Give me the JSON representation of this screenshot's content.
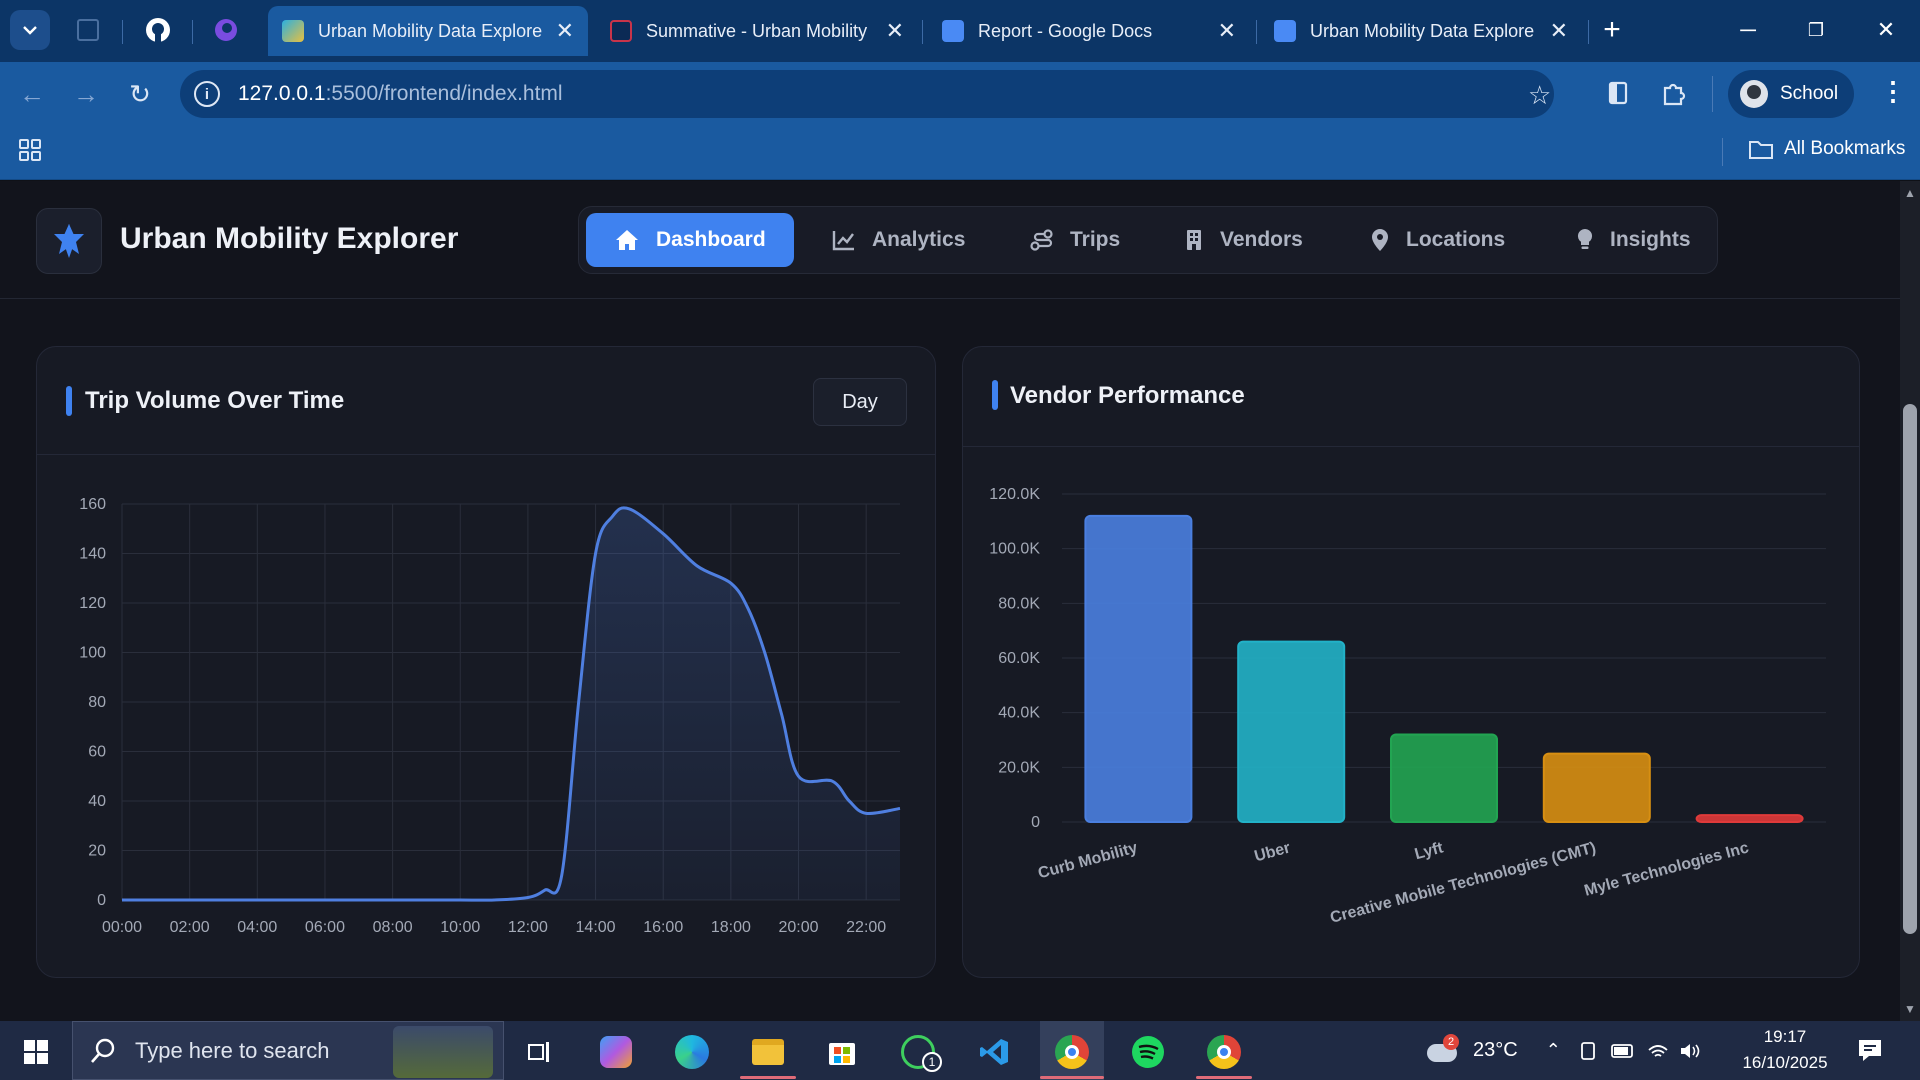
{
  "browser": {
    "tabs": [
      {
        "title": "Urban Mobility Data Explore",
        "active": true
      },
      {
        "title": "Summative - Urban Mobility",
        "active": false
      },
      {
        "title": "Report - Google Docs",
        "active": false
      },
      {
        "title": "Urban Mobility Data Explore",
        "active": false
      }
    ],
    "url_host": "127.0.0.1",
    "url_path": ":5500/frontend/index.html",
    "profile_label": "School",
    "bookmarks_label": "All Bookmarks"
  },
  "app": {
    "brand": "Urban Mobility Explorer",
    "nav": [
      {
        "label": "Dashboard",
        "icon": "home-icon",
        "active": true
      },
      {
        "label": "Analytics",
        "icon": "line-chart-icon",
        "active": false
      },
      {
        "label": "Trips",
        "icon": "route-icon",
        "active": false
      },
      {
        "label": "Vendors",
        "icon": "building-icon",
        "active": false
      },
      {
        "label": "Locations",
        "icon": "map-pin-icon",
        "active": false
      },
      {
        "label": "Insights",
        "icon": "lightbulb-icon",
        "active": false
      }
    ],
    "accent_color": "#3f82f0"
  },
  "trip_card": {
    "title": "Trip Volume Over Time",
    "granularity": "Day"
  },
  "vendor_card": {
    "title": "Vendor Performance"
  },
  "chart_data": [
    {
      "type": "area",
      "title": "Trip Volume Over Time",
      "x": [
        "00:00",
        "01:00",
        "02:00",
        "03:00",
        "04:00",
        "05:00",
        "06:00",
        "07:00",
        "08:00",
        "09:00",
        "10:00",
        "11:00",
        "12:00",
        "12:30",
        "13:00",
        "13:30",
        "14:00",
        "14:30",
        "15:00",
        "16:00",
        "17:00",
        "18:00",
        "18:30",
        "19:00",
        "19:30",
        "20:00",
        "21:00",
        "21:30",
        "22:00",
        "23:00"
      ],
      "values": [
        0,
        0,
        0,
        0,
        0,
        0,
        0,
        0,
        0,
        0,
        0,
        0,
        1,
        4,
        10,
        80,
        140,
        155,
        158,
        148,
        135,
        128,
        118,
        100,
        75,
        50,
        48,
        40,
        35,
        37
      ],
      "x_tick_labels": [
        "00:00",
        "02:00",
        "04:00",
        "06:00",
        "08:00",
        "10:00",
        "12:00",
        "14:00",
        "16:00",
        "18:00",
        "20:00",
        "22:00"
      ],
      "y_tick_labels": [
        "0",
        "20",
        "40",
        "60",
        "80",
        "100",
        "120",
        "140",
        "160"
      ],
      "ylim": [
        0,
        160
      ],
      "grid": true,
      "color": "#4f7fe0"
    },
    {
      "type": "bar",
      "title": "Vendor Performance",
      "categories": [
        "Curb Mobility",
        "Uber",
        "Lyft",
        "Creative Mobile Technologies (CMT)",
        "Myle Technologies Inc"
      ],
      "values": [
        112000,
        66000,
        32000,
        25000,
        2500
      ],
      "colors": [
        "#4a7fe0",
        "#22b2c8",
        "#22a552",
        "#d88f12",
        "#e03a3a"
      ],
      "y_tick_labels": [
        "0",
        "20.0K",
        "40.0K",
        "60.0K",
        "80.0K",
        "100.0K",
        "120.0K"
      ],
      "ylim": [
        0,
        120000
      ],
      "grid": true
    }
  ],
  "taskbar": {
    "search_placeholder": "Type here to search",
    "temperature": "23°C",
    "time": "19:17",
    "date": "16/10/2025",
    "whatsapp_badge": "1",
    "weather_badge": "2"
  }
}
